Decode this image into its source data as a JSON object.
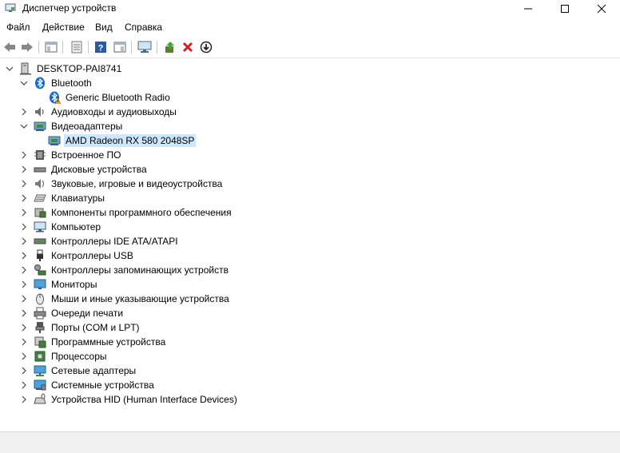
{
  "window": {
    "title": "Диспетчер устройств"
  },
  "menu": [
    "Файл",
    "Действие",
    "Вид",
    "Справка"
  ],
  "toolbar": {
    "buttons": [
      "back-icon",
      "forward-icon",
      "show-hide-tree-icon",
      "properties-icon",
      "help-icon",
      "scan-changes-icon",
      "monitor-icon",
      "update-driver-icon",
      "uninstall-icon",
      "disable-device-icon"
    ]
  },
  "tree": {
    "root": "DESKTOP-PAI8741",
    "nodes": [
      {
        "label": "Bluetooth",
        "icon": "bluetooth-icon",
        "expanded": true,
        "children": [
          {
            "label": "Generic Bluetooth Radio",
            "icon": "bluetooth-warning-icon"
          }
        ]
      },
      {
        "label": "Аудиовходы и аудиовыходы",
        "icon": "audio-io-icon"
      },
      {
        "label": "Видеоадаптеры",
        "icon": "display-adapter-icon",
        "expanded": true,
        "children": [
          {
            "label": "AMD Radeon RX 580 2048SP",
            "icon": "gpu-icon",
            "selected": true
          }
        ]
      },
      {
        "label": "Встроенное ПО",
        "icon": "firmware-icon"
      },
      {
        "label": "Дисковые устройства",
        "icon": "disk-drive-icon"
      },
      {
        "label": "Звуковые, игровые и видеоустройства",
        "icon": "sound-icon"
      },
      {
        "label": "Клавиатуры",
        "icon": "keyboard-icon"
      },
      {
        "label": "Компоненты программного обеспечения",
        "icon": "software-component-icon"
      },
      {
        "label": "Компьютер",
        "icon": "computer-icon"
      },
      {
        "label": "Контроллеры IDE ATA/ATAPI",
        "icon": "ide-controller-icon"
      },
      {
        "label": "Контроллеры USB",
        "icon": "usb-icon"
      },
      {
        "label": "Контроллеры запоминающих устройств",
        "icon": "storage-controller-icon"
      },
      {
        "label": "Мониторы",
        "icon": "monitor-icon"
      },
      {
        "label": "Мыши и иные указывающие устройства",
        "icon": "mouse-icon"
      },
      {
        "label": "Очереди печати",
        "icon": "print-queue-icon"
      },
      {
        "label": "Порты (COM и LPT)",
        "icon": "port-icon"
      },
      {
        "label": "Программные устройства",
        "icon": "software-device-icon"
      },
      {
        "label": "Процессоры",
        "icon": "processor-icon"
      },
      {
        "label": "Сетевые адаптеры",
        "icon": "network-adapter-icon"
      },
      {
        "label": "Системные устройства",
        "icon": "system-device-icon"
      },
      {
        "label": "Устройства HID (Human Interface Devices)",
        "icon": "hid-icon"
      }
    ]
  }
}
